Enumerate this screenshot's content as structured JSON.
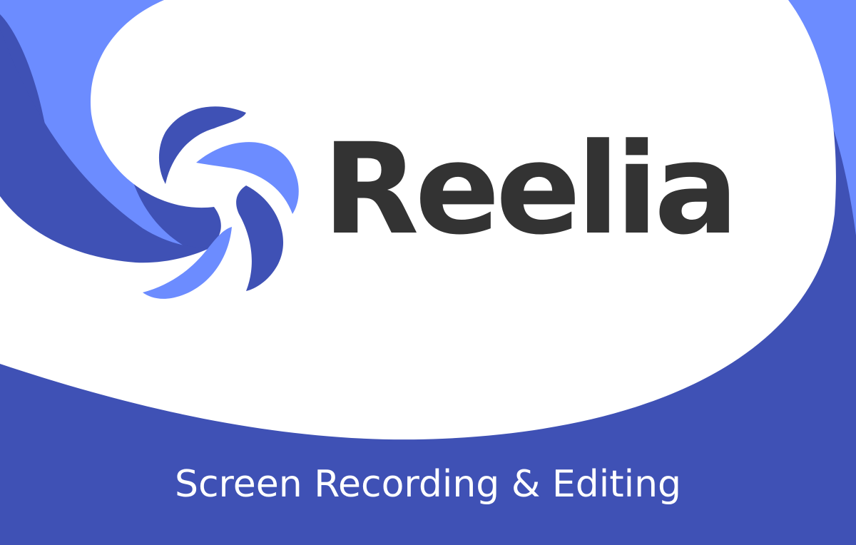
{
  "brand": {
    "name": "Reelia",
    "tagline": "Screen Recording & Editing"
  },
  "colors": {
    "primary_blue": "#3f51b5",
    "light_blue": "#6c8cff",
    "background_white": "#ffffff",
    "wordmark": "#333333",
    "tagline": "#ffffff"
  },
  "icons": {
    "logo": "reel-swirl-logo"
  }
}
